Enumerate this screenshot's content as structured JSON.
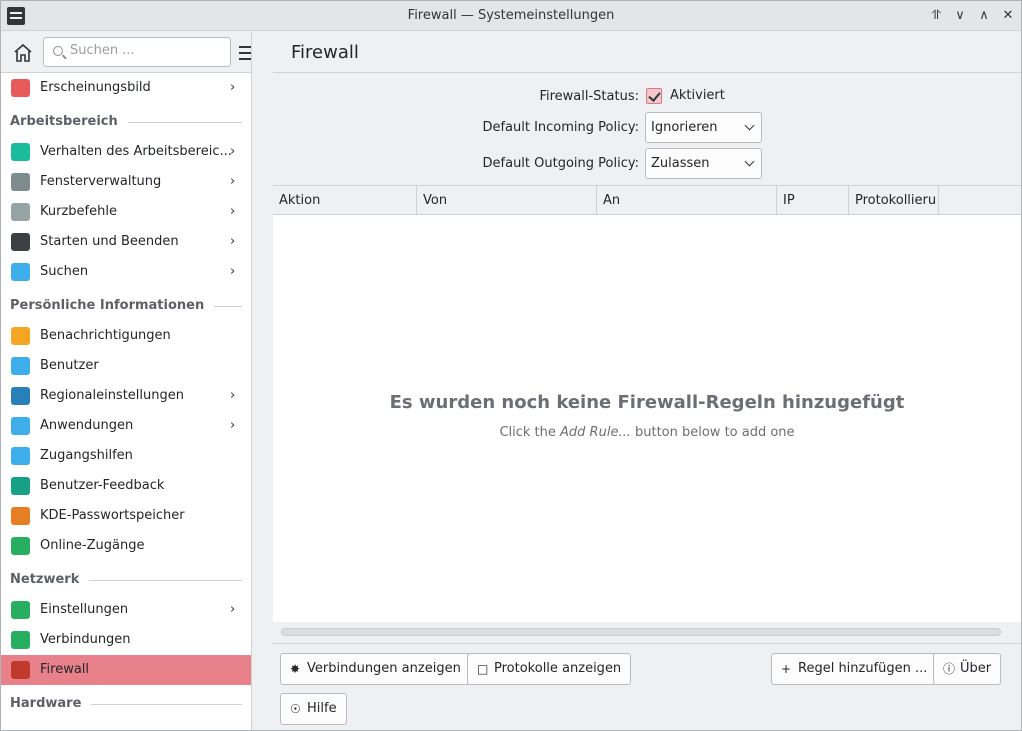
{
  "window": {
    "title": "Firewall — Systemeinstellungen"
  },
  "sidebar": {
    "search_placeholder": "Suchen ...",
    "entries": [
      {
        "kind": "item",
        "label": "Erscheinungsbild",
        "icon": "appearance-icon",
        "color": "#e85a5a",
        "chevron": true
      },
      {
        "kind": "section",
        "label": "Arbeitsbereich"
      },
      {
        "kind": "item",
        "label": "Verhalten des Arbeitsbereic...",
        "icon": "workspace-behavior-icon",
        "color": "#1abc9c",
        "chevron": true
      },
      {
        "kind": "item",
        "label": "Fensterverwaltung",
        "icon": "window-management-icon",
        "color": "#7f8c8d",
        "chevron": true
      },
      {
        "kind": "item",
        "label": "Kurzbefehle",
        "icon": "keyboard-icon",
        "color": "#95a5a6",
        "chevron": true
      },
      {
        "kind": "item",
        "label": "Starten und Beenden",
        "icon": "startup-shutdown-icon",
        "color": "#3b4045",
        "chevron": true
      },
      {
        "kind": "item",
        "label": "Suchen",
        "icon": "search-icon",
        "color": "#3daee9",
        "chevron": true
      },
      {
        "kind": "section",
        "label": "Persönliche Informationen"
      },
      {
        "kind": "item",
        "label": "Benachrichtigungen",
        "icon": "bell-icon",
        "color": "#f5a623",
        "chevron": false
      },
      {
        "kind": "item",
        "label": "Benutzer",
        "icon": "user-icon",
        "color": "#3daee9",
        "chevron": false
      },
      {
        "kind": "item",
        "label": "Regionaleinstellungen",
        "icon": "region-icon",
        "color": "#2980b9",
        "chevron": true
      },
      {
        "kind": "item",
        "label": "Anwendungen",
        "icon": "applications-icon",
        "color": "#3daee9",
        "chevron": true
      },
      {
        "kind": "item",
        "label": "Zugangshilfen",
        "icon": "accessibility-icon",
        "color": "#3daee9",
        "chevron": false
      },
      {
        "kind": "item",
        "label": "Benutzer-Feedback",
        "icon": "feedback-icon",
        "color": "#16a085",
        "chevron": false
      },
      {
        "kind": "item",
        "label": "KDE-Passwortspeicher",
        "icon": "wallet-icon",
        "color": "#e67e22",
        "chevron": false
      },
      {
        "kind": "item",
        "label": "Online-Zugänge",
        "icon": "online-accounts-icon",
        "color": "#27ae60",
        "chevron": false
      },
      {
        "kind": "section",
        "label": "Netzwerk"
      },
      {
        "kind": "item",
        "label": "Einstellungen",
        "icon": "network-settings-icon",
        "color": "#27ae60",
        "chevron": true
      },
      {
        "kind": "item",
        "label": "Verbindungen",
        "icon": "connections-icon",
        "color": "#27ae60",
        "chevron": false
      },
      {
        "kind": "item",
        "label": "Firewall",
        "icon": "firewall-icon",
        "color": "#c0392b",
        "chevron": false,
        "active": true
      },
      {
        "kind": "section",
        "label": "Hardware"
      }
    ]
  },
  "main": {
    "title": "Firewall",
    "status_label": "Firewall-Status:",
    "status_value": "Aktiviert",
    "incoming_label": "Default Incoming Policy:",
    "incoming_value": "Ignorieren",
    "outgoing_label": "Default Outgoing Policy:",
    "outgoing_value": "Zulassen",
    "columns": [
      "Aktion",
      "Von",
      "An",
      "IP",
      "Protokollieru"
    ],
    "empty_title": "Es wurden noch keine Firewall-Regeln hinzugefügt",
    "empty_sub_pre": "Click the ",
    "empty_sub_em": "Add Rule...",
    "empty_sub_post": " button below to add one"
  },
  "buttons": {
    "connections": "Verbindungen anzeigen",
    "logs": "Protokolle anzeigen",
    "add_rule": "Regel hinzufügen ...",
    "about": "Über",
    "help": "Hilfe"
  }
}
